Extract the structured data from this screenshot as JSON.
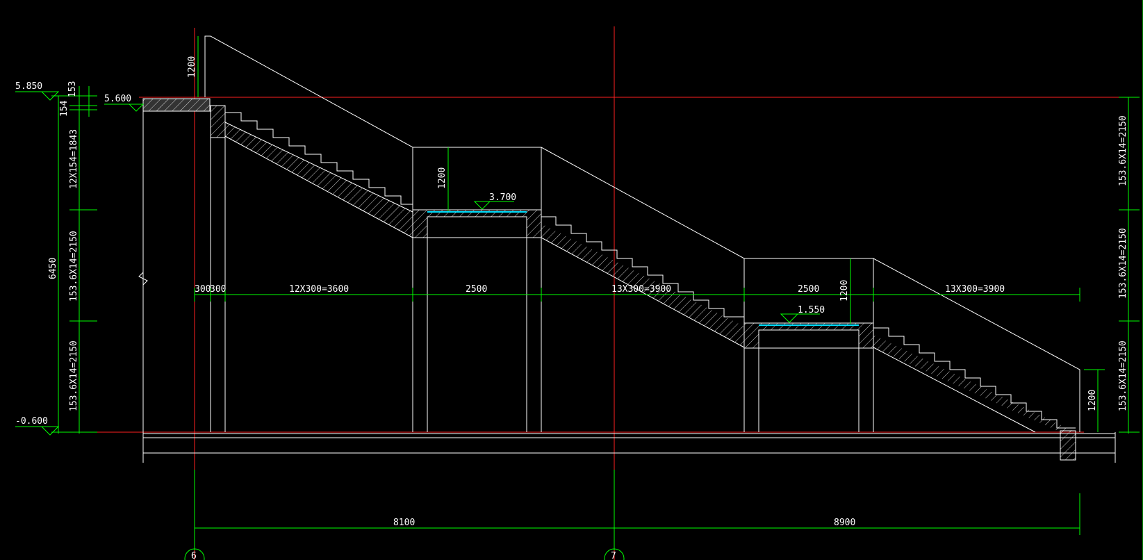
{
  "elevations": {
    "top": "5.850",
    "floor_upper": "5.600",
    "landing_1": "3.700",
    "landing_2": "1.550",
    "bottom": "-0.600"
  },
  "left_dims": {
    "d153": "153",
    "d154": "154",
    "run1": "12X154=1843",
    "run2": "153.6X14=2150",
    "run3": "153.6X14=2150",
    "total": "6450"
  },
  "right_dims": {
    "run1": "153.6X14=2150",
    "run2": "153.6X14=2150",
    "run3": "153.6X14=2150"
  },
  "rail_heights": {
    "top": "1200",
    "landing_1": "1200",
    "landing_2": "1200",
    "bottom": "1200"
  },
  "horizontal_dims": {
    "d300a": "300",
    "d300b": "300",
    "flight1": "12X300=3600",
    "landing1": "2500",
    "flight2": "13X300=3900",
    "landing2": "2500",
    "flight3": "13X300=3900"
  },
  "axis_dims": {
    "span_6_7": "8100",
    "span_7_end": "8900"
  },
  "axes": {
    "a6": "6",
    "a7": "7"
  }
}
